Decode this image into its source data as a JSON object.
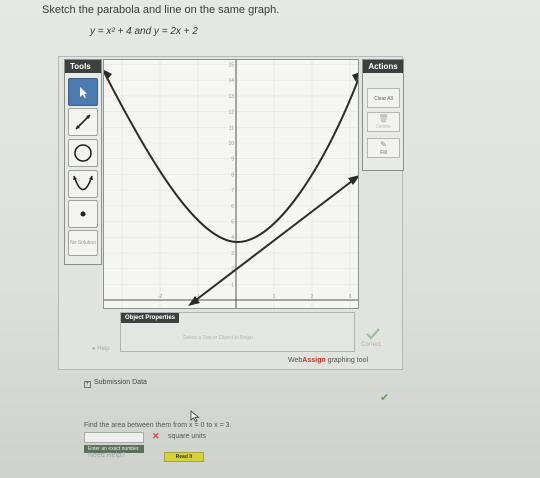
{
  "question": {
    "prompt": "Sketch the parabola and line on the same graph.",
    "equation": "y = x² + 4  and  y = 2x + 2"
  },
  "tools_panel": {
    "title": "Tools",
    "no_solution_label": "No Solution",
    "icons": [
      "pointer-icon",
      "line-icon",
      "circle-icon",
      "parabola-icon",
      "point-icon"
    ]
  },
  "actions_panel": {
    "title": "Actions",
    "clear_all": "Clear All",
    "delete": "Delete",
    "fill": "Fill"
  },
  "graph": {
    "y_tick_labels": [
      "15",
      "14",
      "13",
      "12",
      "11",
      "10",
      "9",
      "8",
      "7",
      "6",
      "5",
      "4",
      "3",
      "2",
      "1"
    ],
    "x_tick_labels": [
      "-2",
      "-1",
      "1",
      "2",
      "3"
    ]
  },
  "object_properties": {
    "title": "Object Properties",
    "hint": "Select a Tool or Object to Begin"
  },
  "correct_label": "Correct",
  "help_label": "Help",
  "brand": {
    "part1": "Web",
    "part2": "Assign",
    "part3": " graphing tool"
  },
  "submission_label": "Submission Data",
  "subquestion": {
    "prompt": "Find the area between them from x = 0 to x = 3.",
    "units": "square units",
    "enter_hint": "Enter an exact number.",
    "need_help": "Need Help?",
    "read_it": "Read It"
  },
  "colors": {
    "curve": "#2b2b2b",
    "title_bar": "#3e3f3f",
    "active_tool": "#4b7bb0"
  }
}
